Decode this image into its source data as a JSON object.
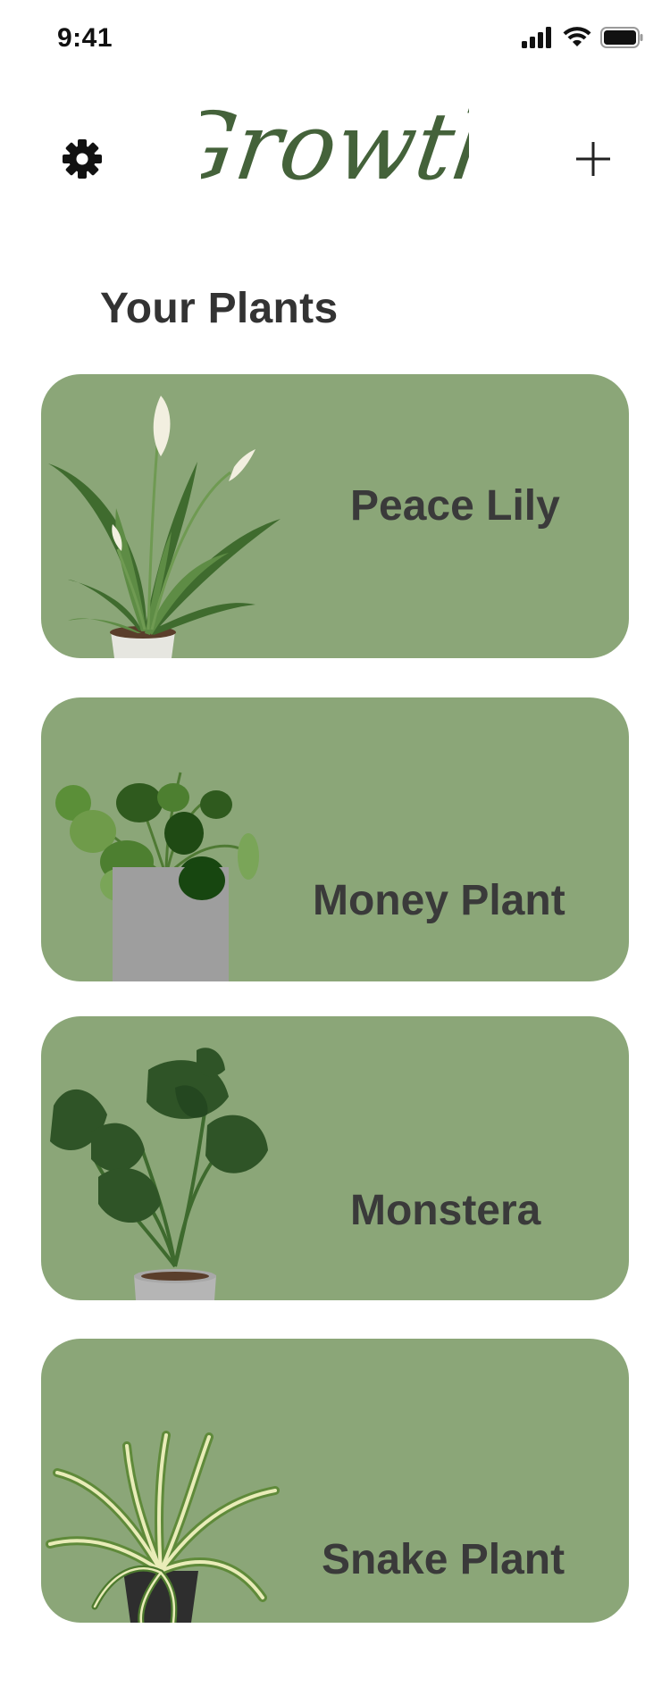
{
  "status_bar": {
    "time": "9:41",
    "icons": [
      "signal-icon",
      "wifi-icon",
      "battery-icon"
    ]
  },
  "header": {
    "app_title": "Growth",
    "settings_icon": "gear-icon",
    "add_icon": "plus-icon"
  },
  "section_title": "Your Plants",
  "colors": {
    "card_background": "#8ba678",
    "title_green": "#44623a",
    "text_dark": "#3a3a3a"
  },
  "plants": [
    {
      "name": "Peace Lily",
      "illustration": "peace-lily-illustration"
    },
    {
      "name": "Money Plant",
      "illustration": "money-plant-illustration"
    },
    {
      "name": "Monstera",
      "illustration": "monstera-illustration"
    },
    {
      "name": "Snake Plant",
      "illustration": "snake-plant-illustration"
    }
  ]
}
